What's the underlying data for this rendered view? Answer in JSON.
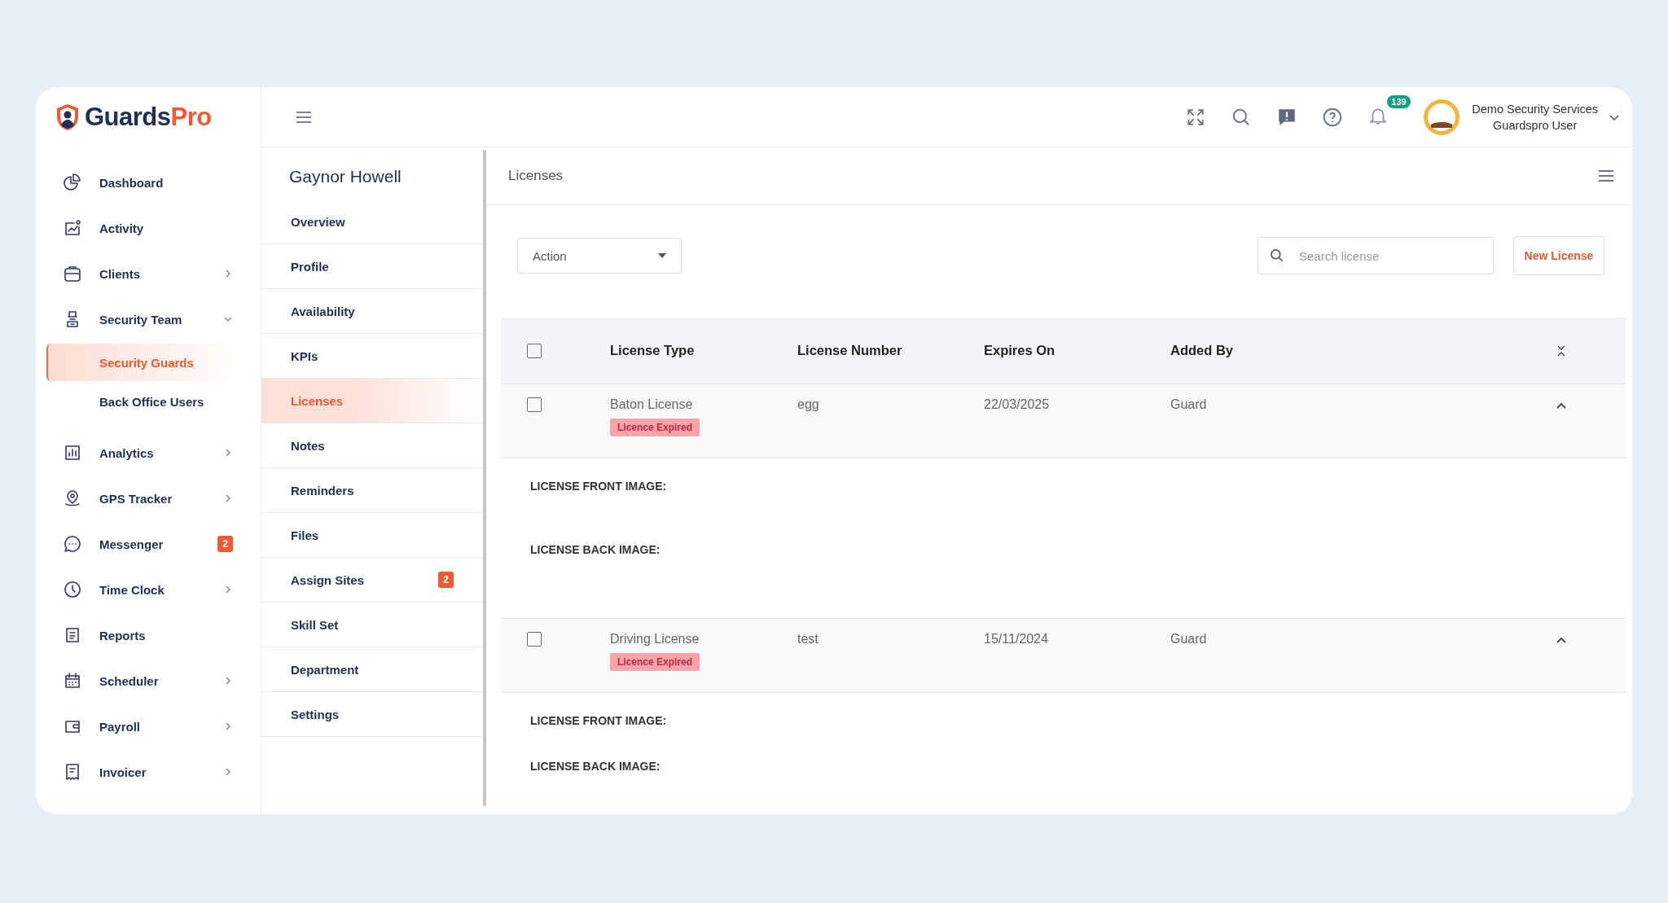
{
  "logo": {
    "text_main": "Guards",
    "text_accent": "Pro"
  },
  "sidebar": {
    "items": [
      {
        "label": "Dashboard",
        "selected": false
      },
      {
        "label": "Activity",
        "selected": false
      },
      {
        "label": "Clients",
        "selected": false,
        "expanded": false
      },
      {
        "label": "Security Team",
        "selected": false,
        "expanded": true,
        "children": [
          {
            "label": "Security Guards",
            "selected": true
          },
          {
            "label": "Back Office Users",
            "selected": false
          }
        ]
      },
      {
        "label": "Analytics",
        "selected": false,
        "expanded": false
      },
      {
        "label": "GPS Tracker",
        "selected": false,
        "expanded": false
      },
      {
        "label": "Messenger",
        "selected": false,
        "badge": "2"
      },
      {
        "label": "Time Clock",
        "selected": false,
        "expanded": false
      },
      {
        "label": "Reports",
        "selected": false
      },
      {
        "label": "Scheduler",
        "selected": false,
        "expanded": false
      },
      {
        "label": "Payroll",
        "selected": false,
        "expanded": false
      },
      {
        "label": "Invoicer",
        "selected": false,
        "expanded": false
      }
    ]
  },
  "header": {
    "notification_count": "139",
    "user_name": "Demo Security Services",
    "user_role": "Guardspro User"
  },
  "profile": {
    "name": "Gaynor Howell",
    "tabs": [
      {
        "label": "Overview",
        "selected": false
      },
      {
        "label": "Profile",
        "selected": false
      },
      {
        "label": "Availability",
        "selected": false
      },
      {
        "label": "KPIs",
        "selected": false
      },
      {
        "label": "Licenses",
        "selected": true
      },
      {
        "label": "Notes",
        "selected": false
      },
      {
        "label": "Reminders",
        "selected": false
      },
      {
        "label": "Files",
        "selected": false
      },
      {
        "label": "Assign Sites",
        "selected": false,
        "badge": "2"
      },
      {
        "label": "Skill Set",
        "selected": false
      },
      {
        "label": "Department",
        "selected": false
      },
      {
        "label": "Settings",
        "selected": false
      }
    ]
  },
  "content": {
    "title": "Licenses",
    "action_select": {
      "value": "Action"
    },
    "search": {
      "placeholder": "Search license"
    },
    "new_button": "New License",
    "table": {
      "all_checked": false,
      "columns": [
        "License Type",
        "License Number",
        "Expires On",
        "Added By"
      ],
      "rows": [
        {
          "checked": false,
          "expanded": true,
          "license_type": "Baton License",
          "status": "Licence Expired",
          "license_number": "egg",
          "expires_on": "22/03/2025",
          "added_by": "Guard",
          "details": [
            "LICENSE FRONT IMAGE:",
            "LICENSE BACK IMAGE:"
          ]
        },
        {
          "checked": false,
          "expanded": true,
          "license_type": "Driving License",
          "status": "Licence Expired",
          "license_number": "test",
          "expires_on": "15/11/2024",
          "added_by": "Guard",
          "details": [
            "LICENSE FRONT IMAGE:",
            "LICENSE BACK IMAGE:"
          ]
        }
      ]
    }
  }
}
